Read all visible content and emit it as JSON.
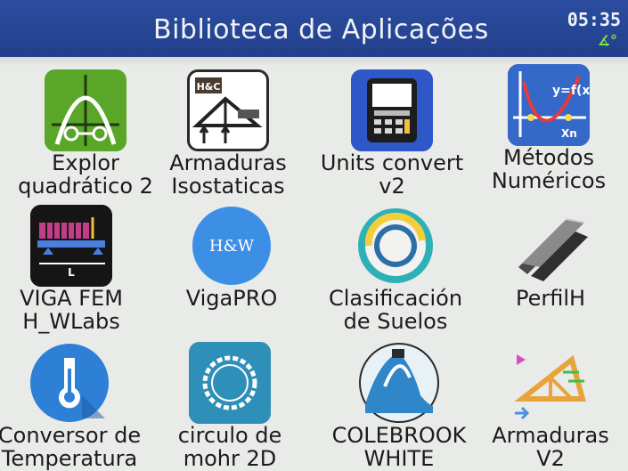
{
  "header": {
    "title": "Biblioteca de Aplicações",
    "time": "05:35",
    "angle_mode": "∡°"
  },
  "apps": [
    {
      "line1": "Explor",
      "line2": "quadrático 2",
      "icon": "parabola-icon"
    },
    {
      "line1": "Armaduras",
      "line2": "Isostaticas",
      "icon": "truss-icon"
    },
    {
      "line1": "Units convert",
      "line2": "v2",
      "icon": "calculator-icon"
    },
    {
      "line1": "Métodos",
      "line2": "Numéricos",
      "icon": "graph-roots-icon"
    },
    {
      "line1": "VIGA FEM",
      "line2": "H_WLabs",
      "icon": "beam-icon"
    },
    {
      "line1": "VigaPRO",
      "line2": "",
      "icon_text": "H&W",
      "icon": "hw-circle-icon"
    },
    {
      "line1": "Clasificación",
      "line2": "de Suelos",
      "icon": "soil-rings-icon"
    },
    {
      "line1": "PerfilH",
      "line2": "",
      "icon": "steel-beam-icon"
    },
    {
      "line1": "Conversor de",
      "line2": "Temperatura",
      "icon": "thermometer-icon"
    },
    {
      "line1": "circulo de",
      "line2": "mohr 2D",
      "icon": "mohr-circle-icon"
    },
    {
      "line1": "COLEBROOK",
      "line2": "WHITE",
      "icon": "pipe-flow-icon"
    },
    {
      "line1": "Armaduras",
      "line2": "V2",
      "icon": "truss-v2-icon"
    }
  ],
  "colors": {
    "titlebar": "#2b4da0",
    "background": "#e9ebe8",
    "angle": "#7ee34a"
  }
}
